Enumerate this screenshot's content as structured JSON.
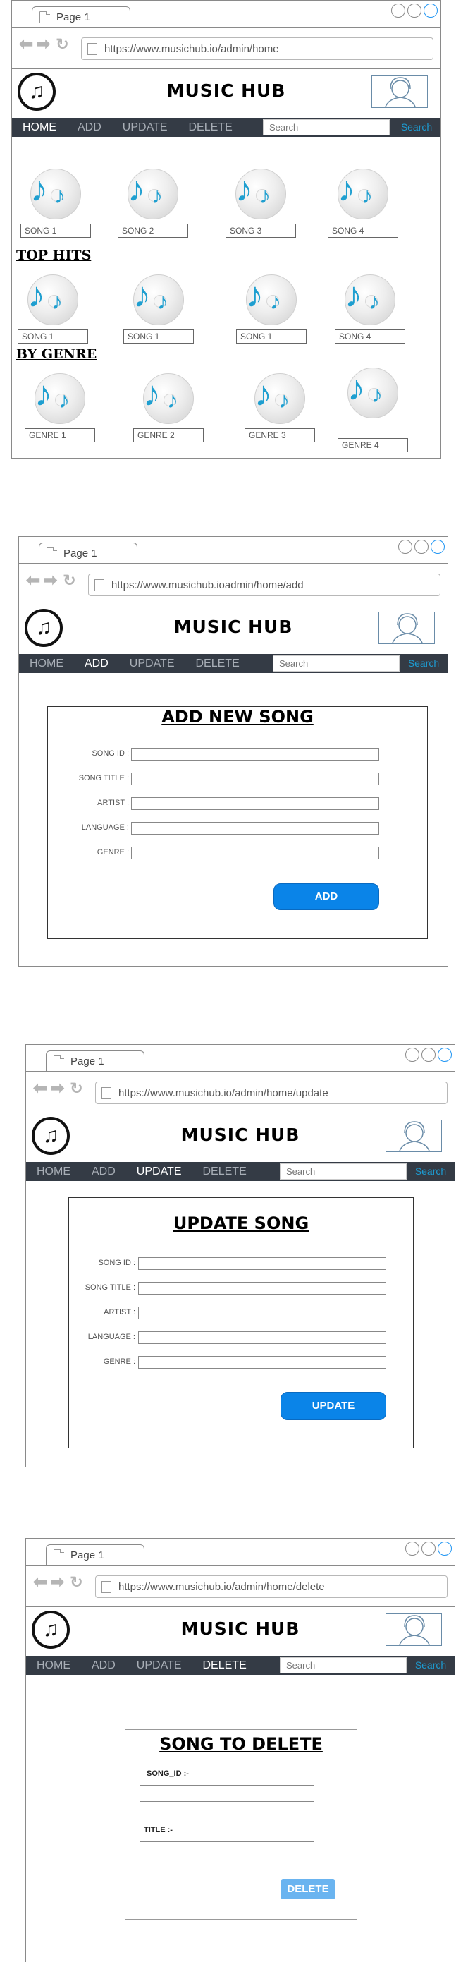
{
  "common": {
    "tab_label": "Page 1",
    "app_title": "MUSIC HUB",
    "search_placeholder": "Search",
    "search_button": "Search",
    "menu": [
      "HOME",
      "ADD",
      "UPDATE",
      "DELETE"
    ]
  },
  "home": {
    "url": "https://www.musichub.io/admin/home",
    "songs": [
      "SONG 1",
      "SONG 2",
      "SONG 3",
      "SONG 4"
    ],
    "top_hits_heading": "TOP HITS",
    "top_hits": [
      "SONG 1",
      "SONG 1",
      "SONG 1",
      "SONG 4"
    ],
    "by_genre_heading": "BY GENRE",
    "genres": [
      "GENRE 1",
      "GENRE 2",
      "GENRE 3",
      "GENRE 4"
    ]
  },
  "add": {
    "url": "https://www.musichub.ioadmin/home/add",
    "form_title": "ADD NEW SONG",
    "fields": [
      "SONG ID :",
      "SONG TITLE :",
      "ARTIST :",
      "LANGUAGE :",
      "GENRE :"
    ],
    "button": "ADD"
  },
  "update": {
    "url": "https://www.musichub.io/admin/home/update",
    "form_title": "UPDATE SONG",
    "fields": [
      "SONG ID :",
      "SONG TITLE :",
      "ARTIST :",
      "LANGUAGE :",
      "GENRE :"
    ],
    "button": "UPDATE"
  },
  "delete": {
    "url": "https://www.musichub.io/admin/home/delete",
    "form_title": "SONG TO DELETE",
    "song_id_label": "SONG_ID :-",
    "title_label": "TITLE :-",
    "button": "DELETE"
  },
  "colors": {
    "menubar": "#343b45",
    "accent_blue": "#0a84e8",
    "search_text": "#1d9bd1",
    "note_blue": "#1f9fd0"
  }
}
